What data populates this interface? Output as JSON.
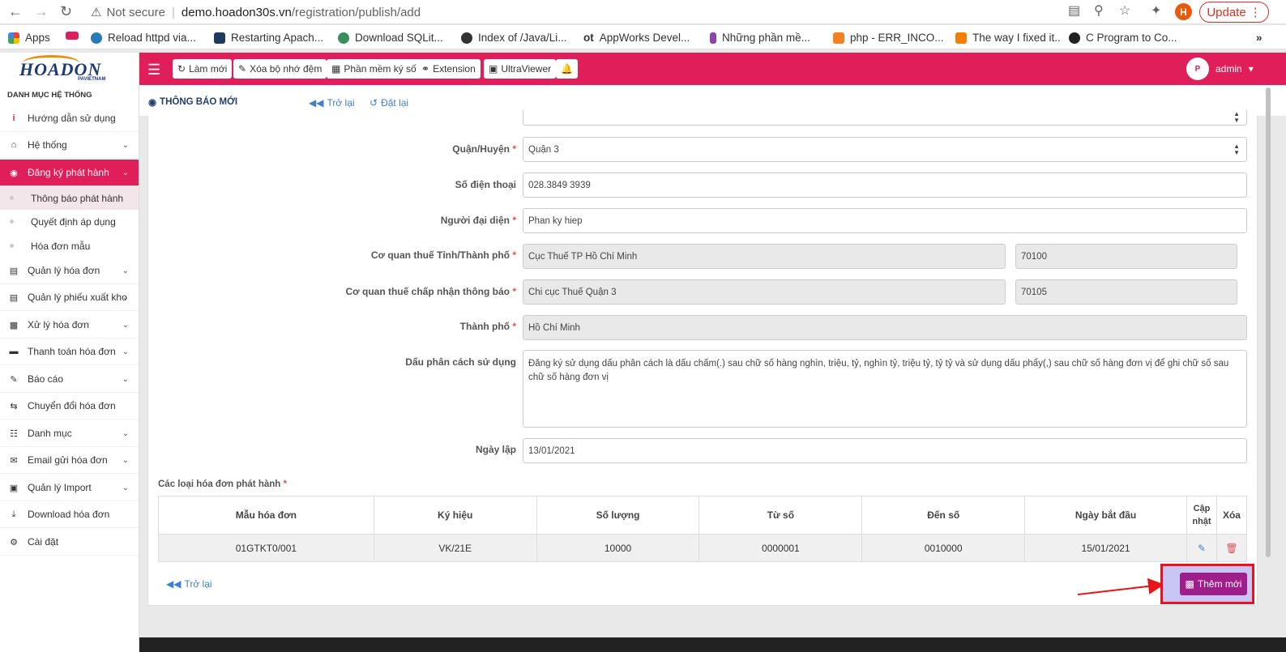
{
  "browser": {
    "security": "Not secure",
    "host": "demo.hoadon30s.vn",
    "path": "/registration/publish/add",
    "update_label": "Update",
    "profile_initial": "H",
    "bookmarks": [
      "Apps",
      "Reload httpd via...",
      "Restarting Apach...",
      "Download SQLit...",
      "Index of /Java/Li...",
      "AppWorks Devel...",
      "Những phần mề...",
      "php - ERR_INCO...",
      "The way I fixed it..",
      "C Program to Co..."
    ]
  },
  "header": {
    "logo": "HOADON",
    "logo_sub": "PAVIETNAM",
    "buttons": [
      "Làm mới",
      "Xóa bộ nhớ đệm",
      "Phần mềm ký số",
      "Extension",
      "UltraViewer"
    ],
    "user": "admin"
  },
  "sidebar": {
    "title": "DANH MỤC HỆ THỐNG",
    "items": [
      {
        "label": "Hướng dẫn sử dụng",
        "icon": "info-icon"
      },
      {
        "label": "Hệ thống",
        "icon": "home-icon"
      },
      {
        "label": "Đăng ký phát hành",
        "icon": "globe-icon"
      },
      {
        "label": "Quản lý hóa đơn",
        "icon": "file-icon"
      },
      {
        "label": "Quản lý phiếu xuất kho",
        "icon": "file-icon"
      },
      {
        "label": "Xử lý hóa đơn",
        "icon": "save-icon"
      },
      {
        "label": "Thanh toán hóa đơn",
        "icon": "card-icon"
      },
      {
        "label": "Báo cáo",
        "icon": "report-icon"
      },
      {
        "label": "Chuyển đổi hóa đơn",
        "icon": "exchange-icon"
      },
      {
        "label": "Danh mục",
        "icon": "sitemap-icon"
      },
      {
        "label": "Email gửi hóa đơn",
        "icon": "envelope-icon"
      },
      {
        "label": "Quản lý Import",
        "icon": "import-icon"
      },
      {
        "label": "Download hóa đơn",
        "icon": "download-icon"
      },
      {
        "label": "Cài đặt",
        "icon": "user-gear-icon"
      }
    ],
    "subitems": [
      "Thông báo phát hành",
      "Quyết định áp dụng",
      "Hóa đơn mẫu"
    ]
  },
  "page": {
    "title": "THÔNG BÁO MỚI",
    "back": "Trở lại",
    "reset": "Đặt lại"
  },
  "form": {
    "district_label": "Quận/Huyện",
    "district_value": "Quận 3",
    "phone_label": "Số điện thoại",
    "phone_value": "028.3849 3939",
    "rep_label": "Người đại diện",
    "rep_value": "Phan ky hiep",
    "tax_city_label": "Cơ quan thuế Tỉnh/Thành phố",
    "tax_city_value": "Cục Thuế TP Hồ Chí Minh",
    "tax_city_code": "70100",
    "tax_accept_label": "Cơ quan thuế chấp nhận thông báo",
    "tax_accept_value": "Chi cục Thuế Quận 3",
    "tax_accept_code": "70105",
    "city_label": "Thành phố",
    "city_value": "Hồ Chí Minh",
    "separator_label": "Dấu phân cách sử dụng",
    "separator_value": "Đăng ký sử dụng dấu phân cách là dấu chấm(.) sau chữ số hàng nghìn, triệu, tỷ, nghìn tỷ, triệu tỷ, tỷ tỷ và sử dụng dấu phẩy(,) sau chữ số hàng đơn vị để ghi chữ số sau chữ số hàng đơn vị",
    "date_label": "Ngày lập",
    "date_value": "13/01/2021"
  },
  "table": {
    "section_label": "Các loại hóa đơn phát hành",
    "headers": [
      "Mẫu hóa đơn",
      "Ký hiệu",
      "Số lượng",
      "Từ số",
      "Đến số",
      "Ngày bắt đầu",
      "Cập nhật",
      "Xóa"
    ],
    "rows": [
      [
        "01GTKT0/001",
        "VK/21E",
        "10000",
        "0000001",
        "0010000",
        "15/01/2021"
      ]
    ]
  },
  "footer_actions": {
    "back": "Trở lại",
    "add": "Thêm mới"
  },
  "colors": {
    "brand": "#e01e5a",
    "add_button": "#a01e8c",
    "link": "#3d7fd1",
    "highlight": "#e8141c"
  }
}
